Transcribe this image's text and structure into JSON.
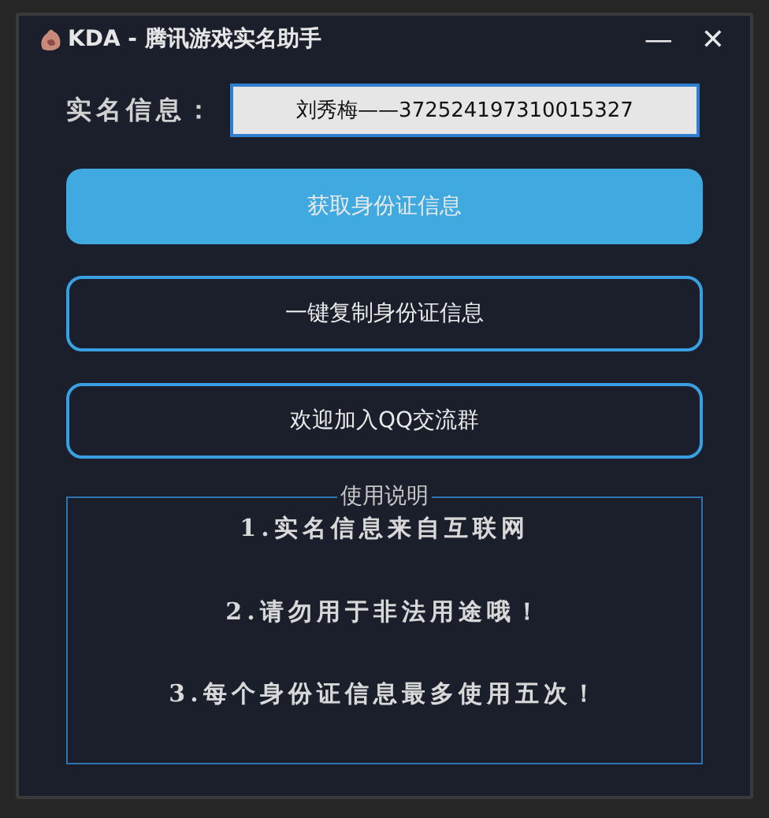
{
  "window": {
    "title": "KDA - 腾讯游戏实名助手",
    "controls": [
      "—",
      "✕"
    ]
  },
  "realname": {
    "label": "实名信息：",
    "value": "刘秀梅——372524197310015327"
  },
  "buttons": [
    {
      "label": "获取身份证信息",
      "kind": "filled"
    },
    {
      "label": "一键复制身份证信息",
      "kind": "outline"
    },
    {
      "label": "欢迎加入QQ交流群",
      "kind": "outline"
    }
  ],
  "instructions": {
    "title": "使用说明",
    "lines": [
      "1.实名信息来自互联网",
      "2.请勿用于非法用途哦！",
      "3.每个身份证信息最多使用五次！"
    ]
  }
}
